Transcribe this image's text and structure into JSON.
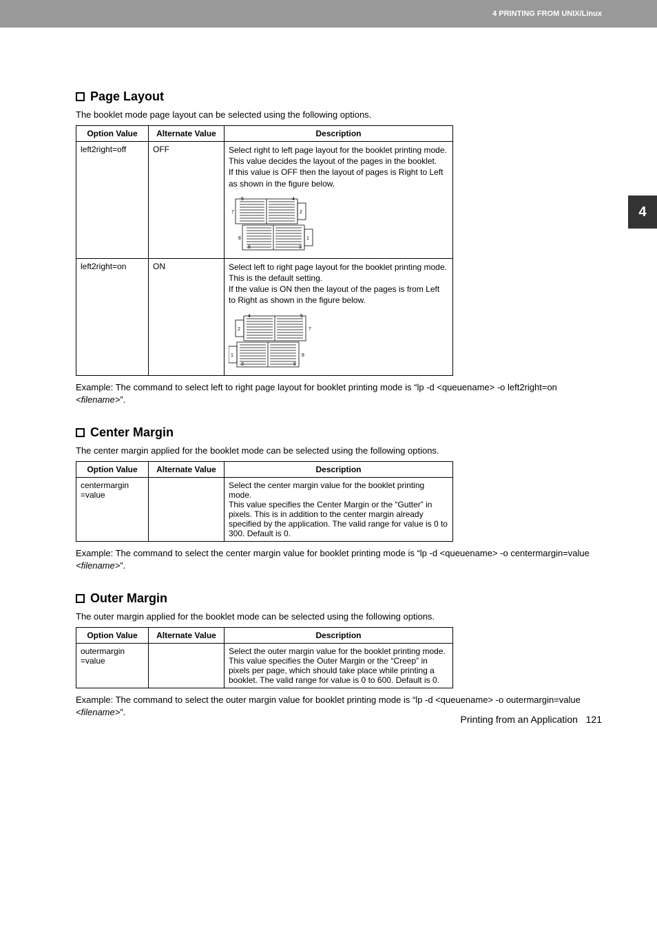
{
  "header": {
    "breadcrumb": "4 PRINTING FROM UNIX/Linux"
  },
  "sideTab": {
    "number": "4"
  },
  "sections": {
    "pageLayout": {
      "title": "Page Layout",
      "intro": "The booklet mode page layout can be selected using the following options.",
      "columns": {
        "opt": "Option Value",
        "alt": "Alternate Value",
        "desc": "Description"
      },
      "rows": [
        {
          "opt": "left2right=off",
          "alt": "OFF",
          "desc": "Select right to left page layout for the booklet printing mode.\nThis value decides the layout of the pages in the booklet.\nIf this value is OFF then the layout of pages is Right to Left as shown in the figure below."
        },
        {
          "opt": "left2right=on",
          "alt": "ON",
          "desc": "Select left to right page layout for the booklet printing mode.\nThis is the default setting.\nIf the value is ON then the layout of the pages is from Left to Right as shown in the figure below."
        }
      ],
      "example": {
        "pre": "Example: The command to select left to right page layout for booklet printing mode is “lp -d <queuename> -o left2right=on ",
        "fn": "<filename>",
        "post": "”."
      }
    },
    "centerMargin": {
      "title": "Center Margin",
      "intro": "The center margin applied for the booklet mode can be selected using the following options.",
      "columns": {
        "opt": "Option Value",
        "alt": "Alternate Value",
        "desc": "Description"
      },
      "rows": [
        {
          "opt": "centermargin\n=value",
          "alt": "",
          "desc": "Select the center margin value for the booklet printing mode.\nThis value specifies the Center Margin or the “Gutter” in pixels. This is in addition to the center margin already specified by the application. The valid range for value is 0 to 300. Default is 0."
        }
      ],
      "example": {
        "pre": "Example: The command to select the center margin value for booklet printing mode is “lp -d <queuename> -o centermargin=value ",
        "fn": "<filename>",
        "post": "”."
      }
    },
    "outerMargin": {
      "title": "Outer Margin",
      "intro": "The outer margin applied for the booklet mode can be selected using the following options.",
      "columns": {
        "opt": "Option Value",
        "alt": "Alternate Value",
        "desc": "Description"
      },
      "rows": [
        {
          "opt": "outermargin\n=value",
          "alt": "",
          "desc": "Select the outer margin value for the booklet printing mode.\nThis value specifies the Outer Margin or the “Creep” in pixels per page, which should take place while printing a booklet. The valid range for value is 0 to 600. Default is 0."
        }
      ],
      "example": {
        "pre": "Example: The command to select the outer margin value for booklet printing mode is “lp -d <queuename> -o outermargin=value ",
        "fn": "<filename>",
        "post": "”."
      }
    }
  },
  "footer": {
    "section": "Printing from an Application",
    "page": "121"
  },
  "chart_data": [
    {
      "type": "diagram",
      "title": "Booklet right-to-left page layout (left2right=off)",
      "spreads": [
        {
          "position": "front",
          "leftPage": 5,
          "rightPage": 4,
          "rightBoxLabel": 2,
          "leftOffsetLabel": 7
        },
        {
          "position": "back",
          "leftPage": 6,
          "rightPage": 3,
          "rightBoxLabel": 1,
          "leftOffsetLabel": 8
        }
      ]
    },
    {
      "type": "diagram",
      "title": "Booklet left-to-right page layout (left2right=on)",
      "spreads": [
        {
          "position": "front",
          "leftPage": 4,
          "rightPage": 5,
          "leftBoxLabel": 2,
          "rightOffsetLabel": 7
        },
        {
          "position": "back",
          "leftPage": 3,
          "rightPage": 6,
          "leftBoxLabel": 1,
          "rightOffsetLabel": 8
        }
      ]
    }
  ]
}
